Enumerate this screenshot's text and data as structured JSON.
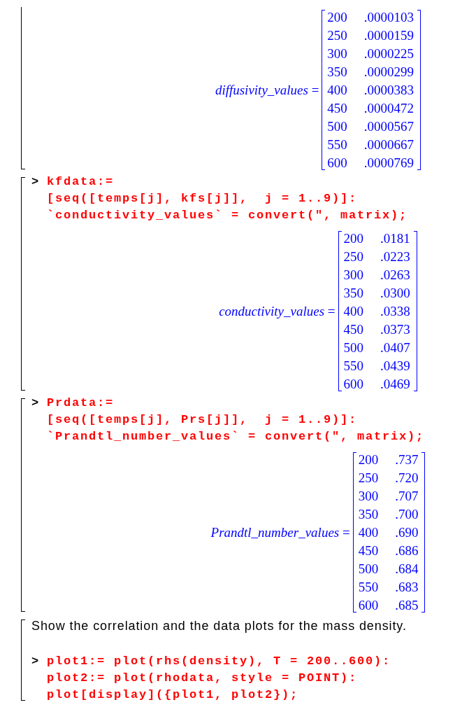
{
  "worksheet": {
    "groups": [
      {
        "top_cut": true,
        "blocks": [
          {
            "kind": "output",
            "lhs": "*diffusivity_values* =",
            "matrix": [
              [
                "200",
                ".0000103"
              ],
              [
                "250",
                ".0000159"
              ],
              [
                "300",
                ".0000225"
              ],
              [
                "350",
                ".0000299"
              ],
              [
                "400",
                ".0000383"
              ],
              [
                "450",
                ".0000472"
              ],
              [
                "500",
                ".0000567"
              ],
              [
                "550",
                ".0000667"
              ],
              [
                "600",
                ".0000769"
              ]
            ]
          }
        ]
      },
      {
        "top_cut": false,
        "blocks": [
          {
            "kind": "input",
            "prompt": ">",
            "lines": [
              "kfdata:=",
              "[seq([temps[j], kfs[j]],  j = 1..9)]:",
              "`conductivity_values` = convert(\", matrix);"
            ]
          },
          {
            "kind": "output",
            "lhs": "*conductivity_values* =",
            "matrix": [
              [
                "200",
                ".0181"
              ],
              [
                "250",
                ".0223"
              ],
              [
                "300",
                ".0263"
              ],
              [
                "350",
                ".0300"
              ],
              [
                "400",
                ".0338"
              ],
              [
                "450",
                ".0373"
              ],
              [
                "500",
                ".0407"
              ],
              [
                "550",
                ".0439"
              ],
              [
                "600",
                ".0469"
              ]
            ]
          }
        ]
      },
      {
        "top_cut": false,
        "blocks": [
          {
            "kind": "input",
            "prompt": ">",
            "lines": [
              "Prdata:=",
              "[seq([temps[j], Prs[j]],  j = 1..9)]:",
              "`Prandtl_number_values` = convert(\", matrix);"
            ]
          },
          {
            "kind": "output",
            "lhs": "*Prandtl_number_values* =",
            "matrix": [
              [
                "200",
                ".737"
              ],
              [
                "250",
                ".720"
              ],
              [
                "300",
                ".707"
              ],
              [
                "350",
                ".700"
              ],
              [
                "400",
                ".690"
              ],
              [
                "450",
                ".686"
              ],
              [
                "500",
                ".684"
              ],
              [
                "550",
                ".683"
              ],
              [
                "600",
                ".685"
              ]
            ]
          }
        ]
      },
      {
        "top_cut": false,
        "blocks": [
          {
            "kind": "text",
            "text": "Show the correlation and the data plots for the mass density."
          },
          {
            "kind": "input",
            "prompt": ">",
            "lines": [
              "plot1:= plot(rhs(density), T = 200..600):",
              "plot2:= plot(rhodata, style = POINT):",
              "plot[display]({plot1, plot2});"
            ]
          }
        ]
      }
    ]
  }
}
